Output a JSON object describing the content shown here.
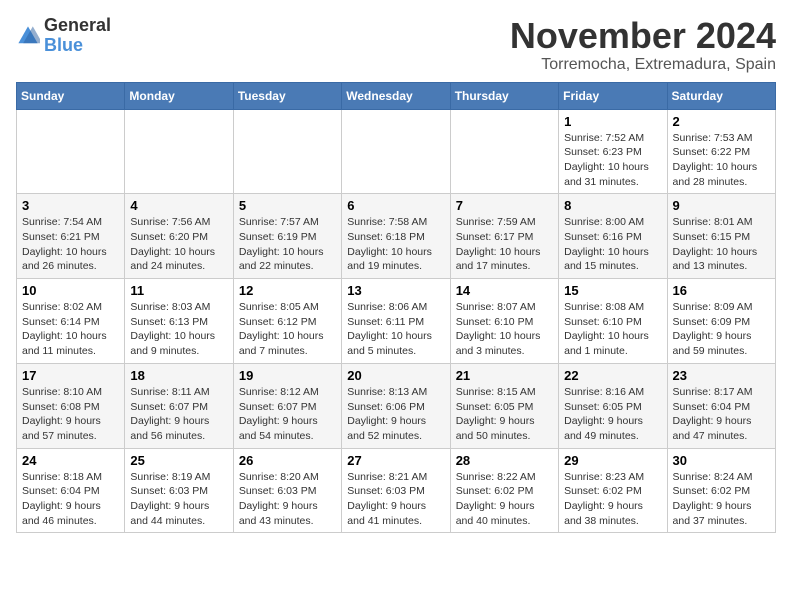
{
  "header": {
    "logo": {
      "general": "General",
      "blue": "Blue"
    },
    "title": "November 2024",
    "location": "Torremocha, Extremadura, Spain"
  },
  "weekdays": [
    "Sunday",
    "Monday",
    "Tuesday",
    "Wednesday",
    "Thursday",
    "Friday",
    "Saturday"
  ],
  "weeks": [
    [
      {
        "day": "",
        "info": ""
      },
      {
        "day": "",
        "info": ""
      },
      {
        "day": "",
        "info": ""
      },
      {
        "day": "",
        "info": ""
      },
      {
        "day": "",
        "info": ""
      },
      {
        "day": "1",
        "info": "Sunrise: 7:52 AM\nSunset: 6:23 PM\nDaylight: 10 hours and 31 minutes."
      },
      {
        "day": "2",
        "info": "Sunrise: 7:53 AM\nSunset: 6:22 PM\nDaylight: 10 hours and 28 minutes."
      }
    ],
    [
      {
        "day": "3",
        "info": "Sunrise: 7:54 AM\nSunset: 6:21 PM\nDaylight: 10 hours and 26 minutes."
      },
      {
        "day": "4",
        "info": "Sunrise: 7:56 AM\nSunset: 6:20 PM\nDaylight: 10 hours and 24 minutes."
      },
      {
        "day": "5",
        "info": "Sunrise: 7:57 AM\nSunset: 6:19 PM\nDaylight: 10 hours and 22 minutes."
      },
      {
        "day": "6",
        "info": "Sunrise: 7:58 AM\nSunset: 6:18 PM\nDaylight: 10 hours and 19 minutes."
      },
      {
        "day": "7",
        "info": "Sunrise: 7:59 AM\nSunset: 6:17 PM\nDaylight: 10 hours and 17 minutes."
      },
      {
        "day": "8",
        "info": "Sunrise: 8:00 AM\nSunset: 6:16 PM\nDaylight: 10 hours and 15 minutes."
      },
      {
        "day": "9",
        "info": "Sunrise: 8:01 AM\nSunset: 6:15 PM\nDaylight: 10 hours and 13 minutes."
      }
    ],
    [
      {
        "day": "10",
        "info": "Sunrise: 8:02 AM\nSunset: 6:14 PM\nDaylight: 10 hours and 11 minutes."
      },
      {
        "day": "11",
        "info": "Sunrise: 8:03 AM\nSunset: 6:13 PM\nDaylight: 10 hours and 9 minutes."
      },
      {
        "day": "12",
        "info": "Sunrise: 8:05 AM\nSunset: 6:12 PM\nDaylight: 10 hours and 7 minutes."
      },
      {
        "day": "13",
        "info": "Sunrise: 8:06 AM\nSunset: 6:11 PM\nDaylight: 10 hours and 5 minutes."
      },
      {
        "day": "14",
        "info": "Sunrise: 8:07 AM\nSunset: 6:10 PM\nDaylight: 10 hours and 3 minutes."
      },
      {
        "day": "15",
        "info": "Sunrise: 8:08 AM\nSunset: 6:10 PM\nDaylight: 10 hours and 1 minute."
      },
      {
        "day": "16",
        "info": "Sunrise: 8:09 AM\nSunset: 6:09 PM\nDaylight: 9 hours and 59 minutes."
      }
    ],
    [
      {
        "day": "17",
        "info": "Sunrise: 8:10 AM\nSunset: 6:08 PM\nDaylight: 9 hours and 57 minutes."
      },
      {
        "day": "18",
        "info": "Sunrise: 8:11 AM\nSunset: 6:07 PM\nDaylight: 9 hours and 56 minutes."
      },
      {
        "day": "19",
        "info": "Sunrise: 8:12 AM\nSunset: 6:07 PM\nDaylight: 9 hours and 54 minutes."
      },
      {
        "day": "20",
        "info": "Sunrise: 8:13 AM\nSunset: 6:06 PM\nDaylight: 9 hours and 52 minutes."
      },
      {
        "day": "21",
        "info": "Sunrise: 8:15 AM\nSunset: 6:05 PM\nDaylight: 9 hours and 50 minutes."
      },
      {
        "day": "22",
        "info": "Sunrise: 8:16 AM\nSunset: 6:05 PM\nDaylight: 9 hours and 49 minutes."
      },
      {
        "day": "23",
        "info": "Sunrise: 8:17 AM\nSunset: 6:04 PM\nDaylight: 9 hours and 47 minutes."
      }
    ],
    [
      {
        "day": "24",
        "info": "Sunrise: 8:18 AM\nSunset: 6:04 PM\nDaylight: 9 hours and 46 minutes."
      },
      {
        "day": "25",
        "info": "Sunrise: 8:19 AM\nSunset: 6:03 PM\nDaylight: 9 hours and 44 minutes."
      },
      {
        "day": "26",
        "info": "Sunrise: 8:20 AM\nSunset: 6:03 PM\nDaylight: 9 hours and 43 minutes."
      },
      {
        "day": "27",
        "info": "Sunrise: 8:21 AM\nSunset: 6:03 PM\nDaylight: 9 hours and 41 minutes."
      },
      {
        "day": "28",
        "info": "Sunrise: 8:22 AM\nSunset: 6:02 PM\nDaylight: 9 hours and 40 minutes."
      },
      {
        "day": "29",
        "info": "Sunrise: 8:23 AM\nSunset: 6:02 PM\nDaylight: 9 hours and 38 minutes."
      },
      {
        "day": "30",
        "info": "Sunrise: 8:24 AM\nSunset: 6:02 PM\nDaylight: 9 hours and 37 minutes."
      }
    ]
  ]
}
